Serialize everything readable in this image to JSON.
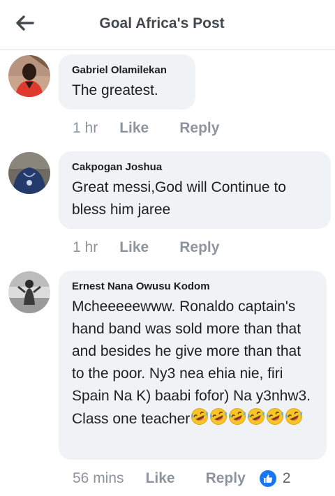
{
  "header": {
    "title": "Goal Africa's Post",
    "back_icon": "arrow-left-icon"
  },
  "comments": [
    {
      "author": "Gabriel Olamilekan",
      "text": "The greatest.",
      "time": "1 hr",
      "like": "Like",
      "reply": "Reply"
    },
    {
      "author": "Cakpogan Joshua",
      "text": "Great messi,God will Continue to bless him jaree",
      "time": "1 hr",
      "like": "Like",
      "reply": "Reply"
    },
    {
      "author": "Ernest Nana Owusu Kodom",
      "text": "Mcheeeeewww. Ronaldo captain's hand band was sold more than that and besides he give more than that to the poor. Ny3 nea ehia nie, firi Spain Na K) baabi fofor) Na y3nhw3. Class one teacher",
      "emoji": "rolling-on-floor-laughing",
      "emoji_count": 6,
      "time": "56 mins",
      "like": "Like",
      "reply": "Reply",
      "reaction_icon": "thumbs-up-icon",
      "reaction_count": "2"
    }
  ],
  "colors": {
    "bubble": "#f0f2f5",
    "meta_text": "#8d949e",
    "like_blue": "#1877f2"
  }
}
